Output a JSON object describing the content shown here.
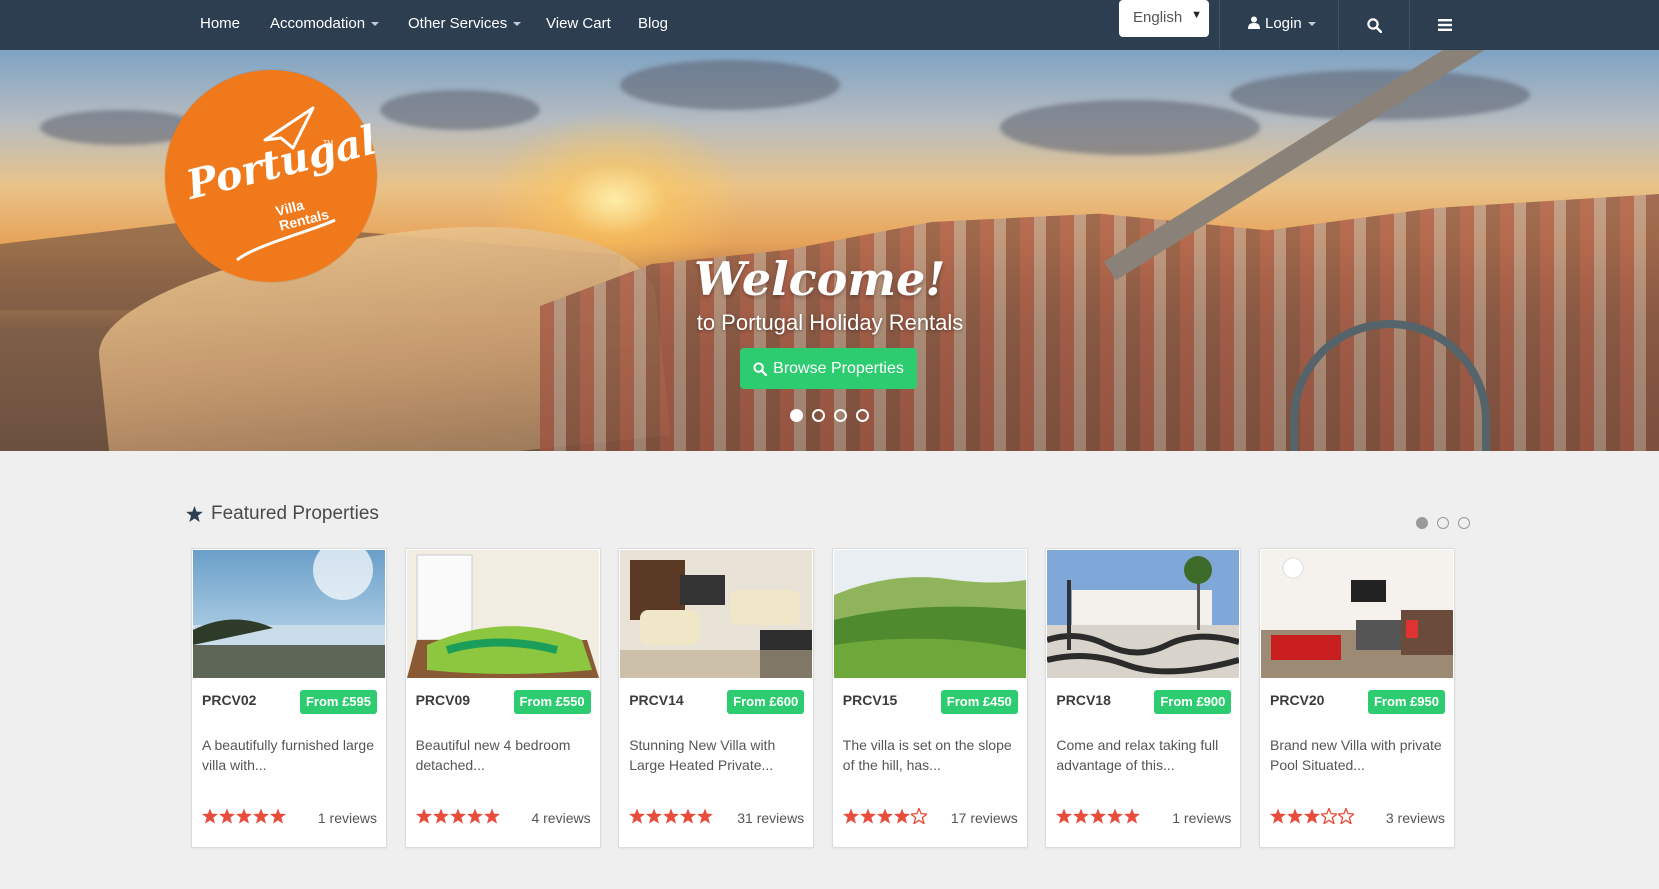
{
  "nav": {
    "items": [
      {
        "label": "Home",
        "dropdown": false
      },
      {
        "label": "Accomodation",
        "dropdown": true
      },
      {
        "label": "Other Services",
        "dropdown": true
      },
      {
        "label": "View Cart",
        "dropdown": false
      },
      {
        "label": "Blog",
        "dropdown": false
      }
    ],
    "language": "English",
    "login_label": "Login",
    "search_icon": "search-icon",
    "menu_icon": "hamburger-icon"
  },
  "hero": {
    "logo_text": "Portugal",
    "logo_subtext": [
      "Villa",
      "Rentals"
    ],
    "logo_tm": "TM",
    "welcome": "Welcome!",
    "subtitle": "to Portugal Holiday Rentals",
    "browse_label": "Browse Properties",
    "slides": 4,
    "active_slide": 1
  },
  "featured": {
    "title": "Featured Properties",
    "pages": 3,
    "active_page": 1,
    "properties": [
      {
        "code": "PRCV02",
        "price": "From £595",
        "desc": "A beautifully furnished large villa with...",
        "rating": 5,
        "reviews": "1 reviews"
      },
      {
        "code": "PRCV09",
        "price": "From £550",
        "desc": "Beautiful new 4 bedroom detached...",
        "rating": 5,
        "reviews": "4 reviews"
      },
      {
        "code": "PRCV14",
        "price": "From £600",
        "desc": "Stunning New Villa with Large Heated Private...",
        "rating": 5,
        "reviews": "31 reviews"
      },
      {
        "code": "PRCV15",
        "price": "From £450",
        "desc": "The villa is set on the slope of the hill, has...",
        "rating": 4,
        "reviews": "17 reviews"
      },
      {
        "code": "PRCV18",
        "price": "From £900",
        "desc": "Come and relax taking full advantage of this...",
        "rating": 5,
        "reviews": "1 reviews"
      },
      {
        "code": "PRCV20",
        "price": "From £950",
        "desc": "Brand new Villa with private Pool Situated...",
        "rating": 3,
        "reviews": "3 reviews"
      }
    ]
  },
  "colors": {
    "nav_bg": "#2c3e50",
    "accent_green": "#2ecc71",
    "star_red": "#e74c3c",
    "logo_orange": "#f07a1b"
  }
}
